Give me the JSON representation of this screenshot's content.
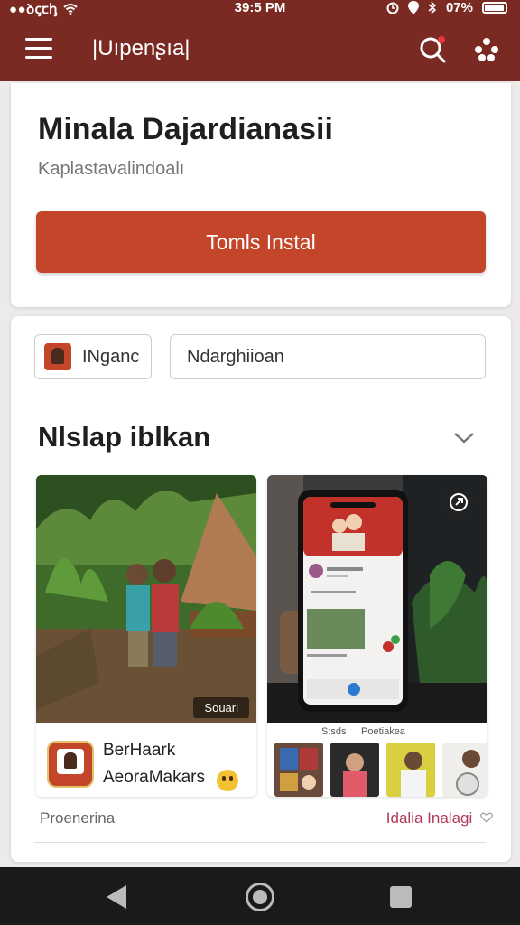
{
  "status_bar": {
    "left": "●●ꝺꞔꞇꞕ",
    "time": "39:5 PM",
    "battery": "07%"
  },
  "app_bar": {
    "title": "|Uıpenʂıa|"
  },
  "hero": {
    "title": "Minala Dajardianasii",
    "subtitle": "Kaplastavalindoalı",
    "install_label": "Tomls Instal"
  },
  "filters": {
    "chip1_label": "INganc",
    "chip2_label": "Ndarghiioan"
  },
  "section": {
    "title": "Nlslap iblkan"
  },
  "tiles": [
    {
      "badge": "Souarl",
      "name_line1": "BerHaark",
      "name_line2": "AeoraMakars"
    },
    {
      "labels": [
        "S:sds",
        "Poetiakea"
      ]
    }
  ],
  "footer": {
    "left": "Proenerina",
    "right": "Idalia Inalagi"
  },
  "colors": {
    "app_bar": "#7a2a22",
    "accent": "#c3452a",
    "link": "#b03a5a"
  },
  "icons": [
    "menu-icon",
    "search-icon",
    "more-dots-icon",
    "chevron-down-icon",
    "share-icon",
    "back-icon",
    "home-icon",
    "recents-icon"
  ]
}
